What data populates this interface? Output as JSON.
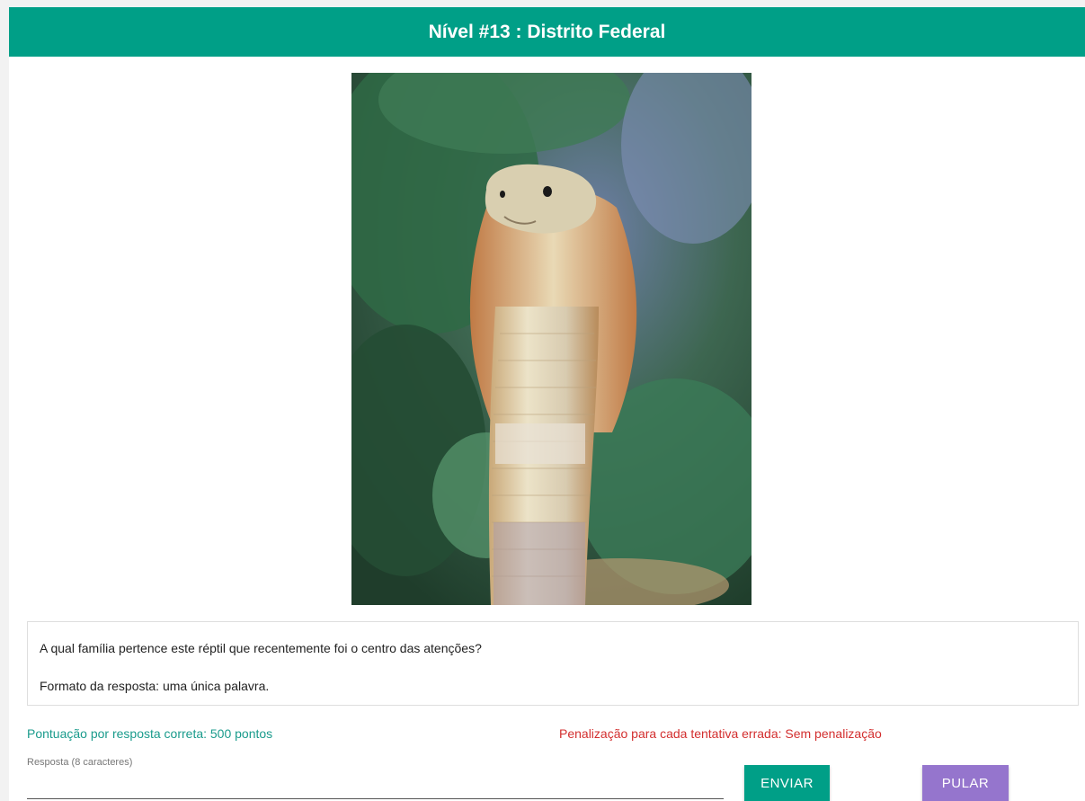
{
  "level": {
    "title": "Nível #13 : Distrito Federal"
  },
  "image": {
    "alt": "cobra"
  },
  "question": {
    "text": "A qual família pertence este réptil que recentemente foi o centro das atenções?",
    "format": "Formato da resposta: uma única palavra."
  },
  "scoring": {
    "points": "Pontuação por resposta correta: 500 pontos",
    "penalty": "Penalização para cada tentativa errada: Sem penalização"
  },
  "answer": {
    "label": "Resposta (8 caracteres)",
    "value": ""
  },
  "buttons": {
    "send": "ENVIAR",
    "skip": "PULAR"
  },
  "colors": {
    "header": "#009f87",
    "send": "#009f87",
    "skip": "#9575cd",
    "points": "#1a9b8c",
    "penalty": "#d32f2f"
  }
}
